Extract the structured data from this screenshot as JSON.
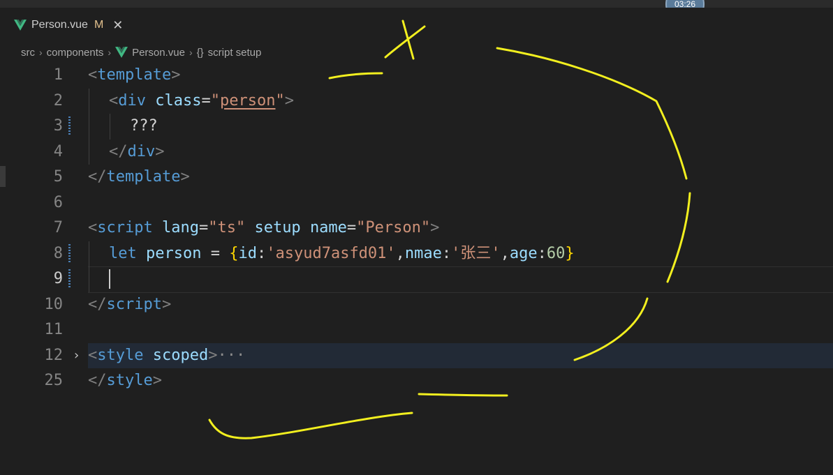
{
  "timer": {
    "time": "03:26"
  },
  "tab": {
    "filename": "Person.vue",
    "status": "M",
    "close_glyph": "✕",
    "icon": "vue-icon"
  },
  "breadcrumb": {
    "items": [
      "src",
      "components",
      "Person.vue",
      "script setup"
    ],
    "separator": "›",
    "symbol": "{}"
  },
  "editor": {
    "cursor_line": 9,
    "lines": [
      {
        "num": "1",
        "tokens": [
          [
            "<",
            "punct"
          ],
          [
            "template",
            "tag"
          ],
          [
            ">",
            "punct"
          ]
        ]
      },
      {
        "num": "2",
        "tokens": [
          [
            "<",
            "punct"
          ],
          [
            "div",
            "tag"
          ],
          [
            " ",
            "text"
          ],
          [
            "class",
            "attr"
          ],
          [
            "=",
            "text"
          ],
          [
            "\"",
            "str"
          ],
          [
            "person",
            "str-u"
          ],
          [
            "\"",
            "str"
          ],
          [
            ">",
            "punct"
          ]
        ]
      },
      {
        "num": "3",
        "tokens": [
          [
            "???",
            "text"
          ]
        ]
      },
      {
        "num": "4",
        "tokens": [
          [
            "</",
            "punct"
          ],
          [
            "div",
            "tag"
          ],
          [
            ">",
            "punct"
          ]
        ]
      },
      {
        "num": "5",
        "tokens": [
          [
            "</",
            "punct"
          ],
          [
            "template",
            "tag"
          ],
          [
            ">",
            "punct"
          ]
        ]
      },
      {
        "num": "6",
        "tokens": []
      },
      {
        "num": "7",
        "tokens": [
          [
            "<",
            "punct"
          ],
          [
            "script",
            "tag"
          ],
          [
            " ",
            "text"
          ],
          [
            "lang",
            "attr"
          ],
          [
            "=",
            "text"
          ],
          [
            "\"ts\"",
            "str"
          ],
          [
            " ",
            "text"
          ],
          [
            "setup",
            "attr"
          ],
          [
            " ",
            "text"
          ],
          [
            "name",
            "attr"
          ],
          [
            "=",
            "text"
          ],
          [
            "\"Person\"",
            "str"
          ],
          [
            ">",
            "punct"
          ]
        ]
      },
      {
        "num": "8",
        "tokens": [
          [
            "let",
            "kw"
          ],
          [
            " ",
            "text"
          ],
          [
            "person",
            "var"
          ],
          [
            " = ",
            "text"
          ],
          [
            "{",
            "brace"
          ],
          [
            "id",
            "var"
          ],
          [
            ":",
            "text"
          ],
          [
            "'asyud7asfd01'",
            "str"
          ],
          [
            ",",
            "text"
          ],
          [
            "nmae",
            "var"
          ],
          [
            ":",
            "text"
          ],
          [
            "'张三'",
            "str"
          ],
          [
            ",",
            "text"
          ],
          [
            "age",
            "var"
          ],
          [
            ":",
            "text"
          ],
          [
            "60",
            "num"
          ],
          [
            "}",
            "brace"
          ]
        ]
      },
      {
        "num": "9",
        "tokens": []
      },
      {
        "num": "10",
        "tokens": [
          [
            "</",
            "punct"
          ],
          [
            "script",
            "tag"
          ],
          [
            ">",
            "punct"
          ]
        ]
      },
      {
        "num": "11",
        "tokens": []
      },
      {
        "num": "12",
        "tokens": [
          [
            "<",
            "punct"
          ],
          [
            "style",
            "tag"
          ],
          [
            " ",
            "text"
          ],
          [
            "scoped",
            "attr"
          ],
          [
            ">",
            "punct"
          ],
          [
            "···",
            "ellipsis"
          ]
        ],
        "folded": true,
        "fold_glyph": "›"
      },
      {
        "num": "25",
        "tokens": [
          [
            "</",
            "punct"
          ],
          [
            "style",
            "tag"
          ],
          [
            ">",
            "punct"
          ]
        ]
      }
    ]
  },
  "colors": {
    "annotation": "#f2ef1f",
    "tag": "#569cd6",
    "string": "#ce9178",
    "attribute": "#9cdcfe",
    "number": "#b5cea8",
    "brace": "#ffd700"
  }
}
